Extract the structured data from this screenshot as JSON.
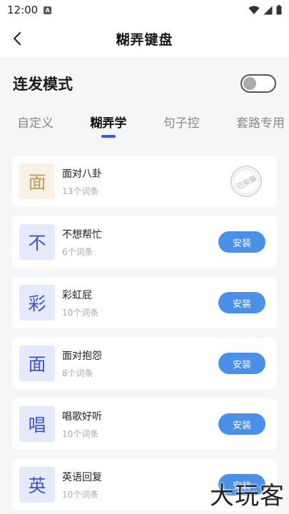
{
  "status": {
    "time": "12:00",
    "notification": "A"
  },
  "header": {
    "title": "糊弄键盘"
  },
  "mode": {
    "label": "连发模式",
    "enabled": false
  },
  "tabs": [
    {
      "label": "自定义",
      "active": false
    },
    {
      "label": "糊弄学",
      "active": true
    },
    {
      "label": "句子控",
      "active": false
    },
    {
      "label": "套路专用",
      "active": false
    }
  ],
  "items": [
    {
      "char": "面",
      "title": "面对八卦",
      "count": "13个词条",
      "installed": true,
      "stamp": "已安装",
      "icon_color": "orange"
    },
    {
      "char": "不",
      "title": "不想帮忙",
      "count": "6个词条",
      "installed": false,
      "button": "安装",
      "icon_color": "blue"
    },
    {
      "char": "彩",
      "title": "彩虹屁",
      "count": "10个词条",
      "installed": false,
      "button": "安装",
      "icon_color": "blue"
    },
    {
      "char": "面",
      "title": "面对抱怨",
      "count": "8个词条",
      "installed": false,
      "button": "安装",
      "icon_color": "blue"
    },
    {
      "char": "唱",
      "title": "唱歌好听",
      "count": "10个词条",
      "installed": false,
      "button": "安装",
      "icon_color": "blue"
    },
    {
      "char": "英",
      "title": "英语回复",
      "count": "10个词条",
      "installed": false,
      "button": "安装",
      "icon_color": "blue"
    }
  ],
  "watermark": "大玩客"
}
